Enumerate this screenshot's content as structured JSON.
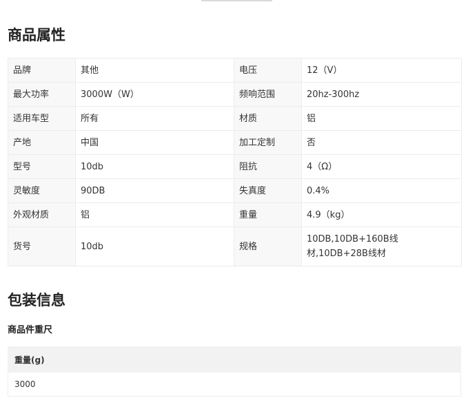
{
  "attributes": {
    "title": "商品属性",
    "rows": [
      {
        "k1": "品牌",
        "v1": "其他",
        "k2": "电压",
        "v2": "12（V）"
      },
      {
        "k1": "最大功率",
        "v1": "3000W（W）",
        "k2": "频响范围",
        "v2": "20hz-300hz"
      },
      {
        "k1": "适用车型",
        "v1": "所有",
        "k2": "材质",
        "v2": "铝"
      },
      {
        "k1": "产地",
        "v1": "中国",
        "k2": "加工定制",
        "v2": "否"
      },
      {
        "k1": "型号",
        "v1": "10db",
        "k2": "阻抗",
        "v2": "4（Ω）"
      },
      {
        "k1": "灵敏度",
        "v1": "90DB",
        "k2": "失真度",
        "v2": "0.4%"
      },
      {
        "k1": "外观材质",
        "v1": "铝",
        "k2": "重量",
        "v2": "4.9（kg）"
      },
      {
        "k1": "货号",
        "v1": "10db",
        "k2": "规格",
        "v2": "10DB,10DB+160B线材,10DB+28B线材"
      }
    ]
  },
  "packaging": {
    "title": "包装信息",
    "subtitle": "商品件重尺",
    "weight_header": "重量(g)",
    "weight_value": "3000"
  }
}
